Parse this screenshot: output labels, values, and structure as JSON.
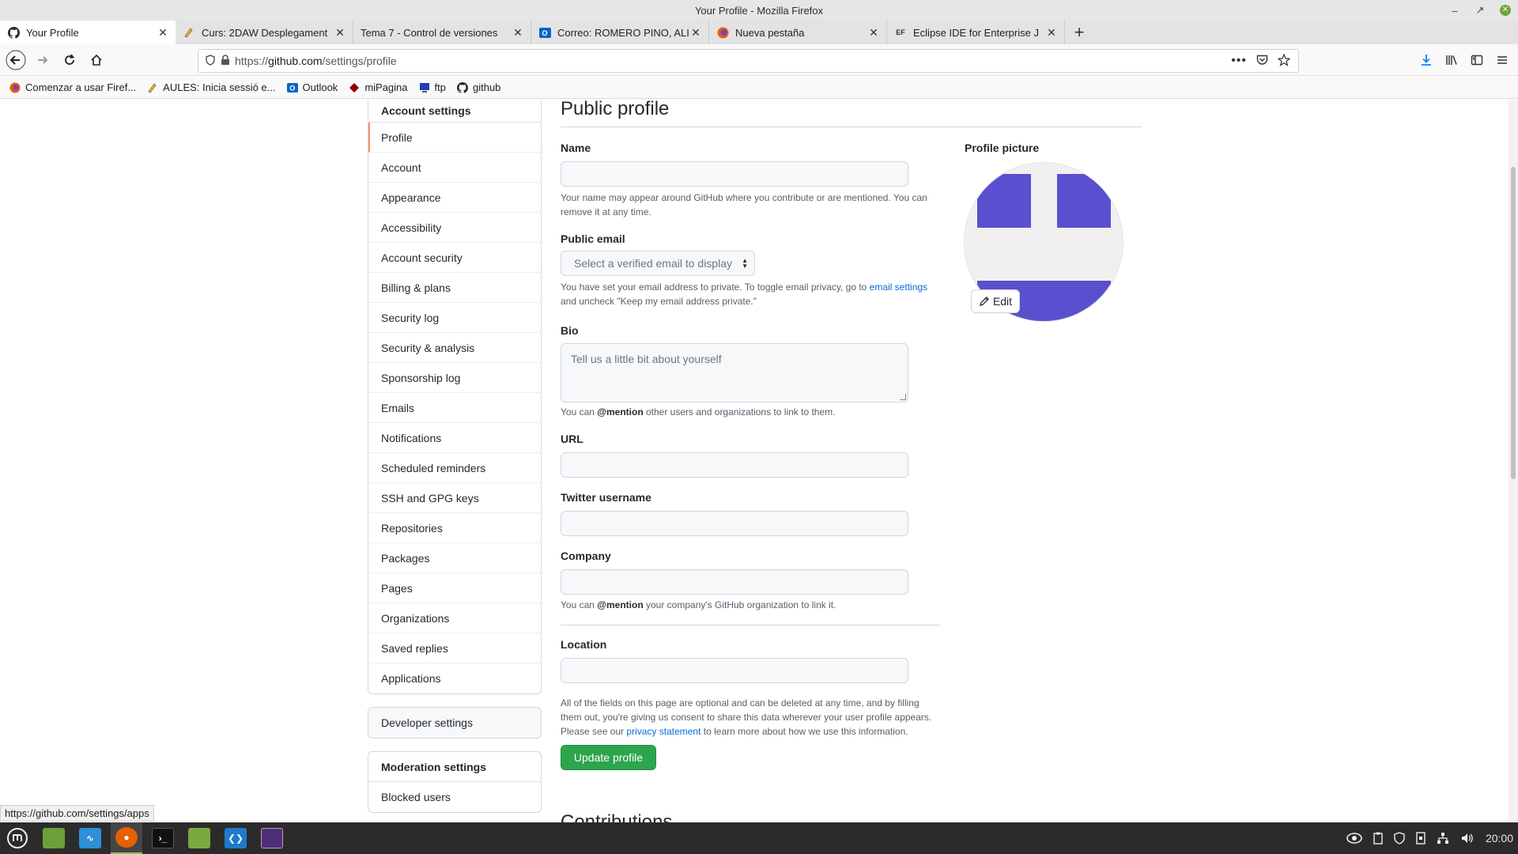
{
  "window": {
    "title": "Your Profile - Mozilla Firefox"
  },
  "tabs": [
    {
      "label": "Your Profile",
      "icon": "github-icon",
      "active": true
    },
    {
      "label": "Curs: 2DAW Desplegament",
      "icon": "moodle-icon"
    },
    {
      "label": "Tema 7 - Control de versiones",
      "icon": ""
    },
    {
      "label": "Correo: ROMERO PINO, ALI",
      "icon": "outlook-icon"
    },
    {
      "label": "Nueva pestaña",
      "icon": "firefox-icon"
    },
    {
      "label": "Eclipse IDE for Enterprise J",
      "icon": "eclipse-icon"
    }
  ],
  "url": {
    "prefix": "https://",
    "host": "github.com",
    "path": "/settings/profile"
  },
  "bookmarks": [
    {
      "label": "Comenzar a usar Firef...",
      "icon": "firefox-icon"
    },
    {
      "label": "AULES: Inicia sessió e...",
      "icon": "moodle-icon"
    },
    {
      "label": "Outlook",
      "icon": "outlook-icon"
    },
    {
      "label": "miPagina",
      "icon": "diamond-icon"
    },
    {
      "label": "ftp",
      "icon": "ftp-icon"
    },
    {
      "label": "github",
      "icon": "github-icon"
    }
  ],
  "sidebar": {
    "account_heading": "Account settings",
    "items": [
      "Profile",
      "Account",
      "Appearance",
      "Accessibility",
      "Account security",
      "Billing & plans",
      "Security log",
      "Security & analysis",
      "Sponsorship log",
      "Emails",
      "Notifications",
      "Scheduled reminders",
      "SSH and GPG keys",
      "Repositories",
      "Packages",
      "Pages",
      "Organizations",
      "Saved replies",
      "Applications"
    ],
    "selected": "Profile",
    "developer": "Developer settings",
    "moderation_heading": "Moderation settings",
    "moderation_items": [
      "Blocked users"
    ]
  },
  "profile": {
    "title": "Public profile",
    "name_label": "Name",
    "name_note": "Your name may appear around GitHub where you contribute or are mentioned. You can remove it at any time.",
    "email_label": "Public email",
    "email_placeholder": "Select a verified email to display",
    "email_note_1": "You have set your email address to private. To toggle email privacy, go to",
    "email_note_link": "email settings",
    "email_note_2": "and uncheck \"Keep my email address private.\"",
    "bio_label": "Bio",
    "bio_placeholder": "Tell us a little bit about yourself",
    "bio_note_1": "You can",
    "bio_note_mention": "@mention",
    "bio_note_2": "other users and organizations to link to them.",
    "url_label": "URL",
    "twitter_label": "Twitter username",
    "company_label": "Company",
    "company_note_1": "You can",
    "company_note_mention": "@mention",
    "company_note_2": "your company's GitHub organization to link it.",
    "location_label": "Location",
    "consent_1": "All of the fields on this page are optional and can be deleted at any time, and by filling them out, you're giving us consent to share this data wherever your user profile appears. Please see our",
    "consent_link": "privacy statement",
    "consent_2": "to learn more about how we use this information.",
    "update_button": "Update profile",
    "contributions_title": "Contributions",
    "picture_label": "Profile picture",
    "edit_button": "Edit"
  },
  "status_link": "https://github.com/settings/apps",
  "taskbar": {
    "apps": [
      "mint-menu-icon",
      "files-icon",
      "monitor-icon",
      "firefox-icon",
      "terminal-icon",
      "folder-icon",
      "vscode-icon",
      "eclipse-icon"
    ],
    "clock": "20:00"
  },
  "colors": {
    "accent_green": "#2da44e",
    "link_blue": "#0969da",
    "avatar_purple": "#5a4fcf",
    "selected_marker": "#fd8c73"
  }
}
